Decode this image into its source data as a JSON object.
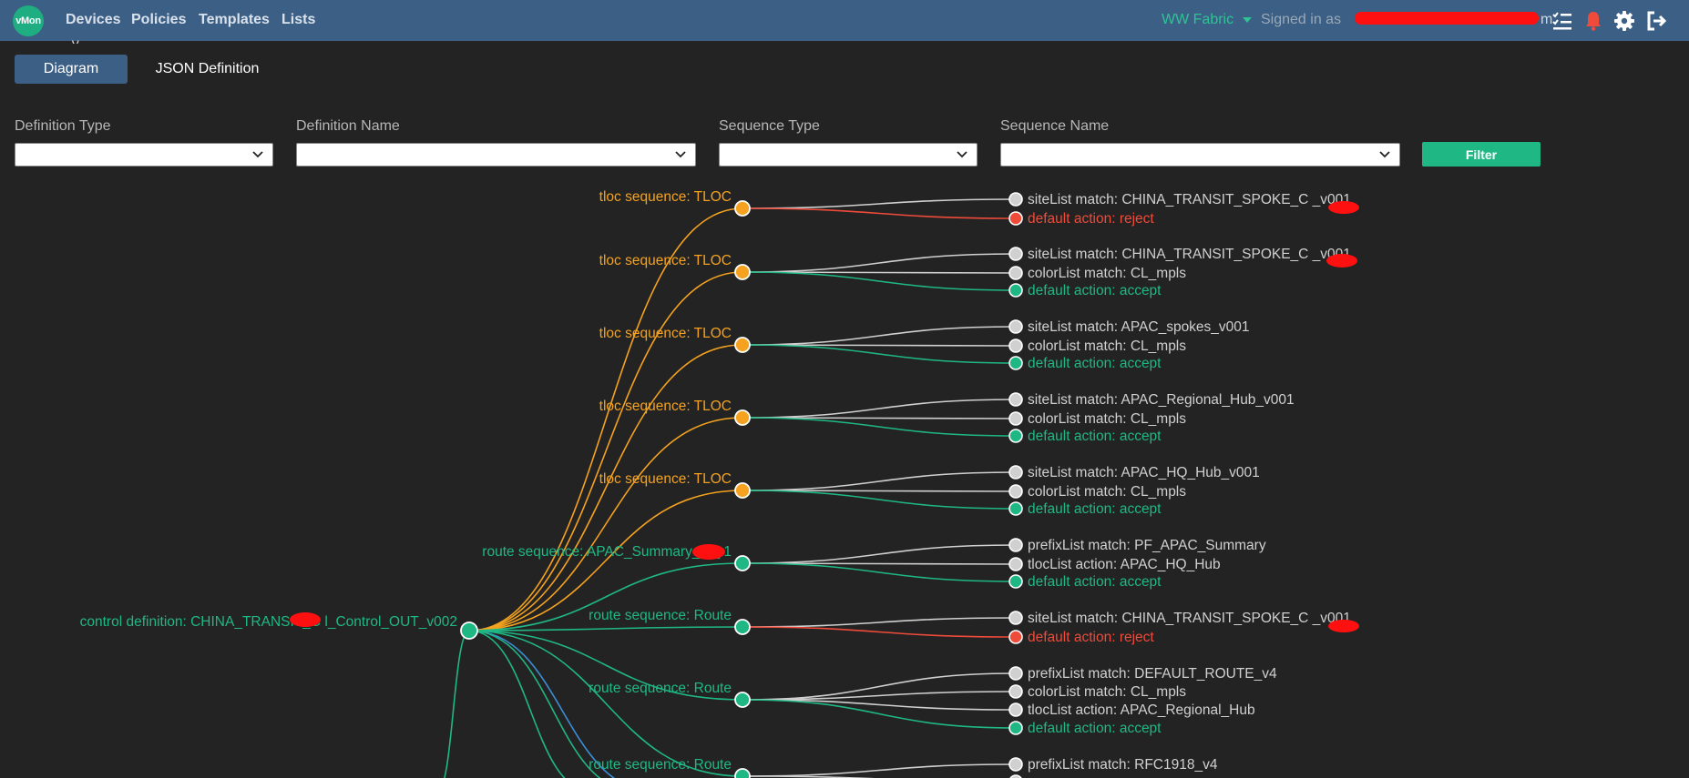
{
  "app": {
    "logo_text": "vMon"
  },
  "nav": {
    "links": [
      "Devices",
      "Policies",
      "Templates",
      "Lists"
    ],
    "fabric": "WW Fabric",
    "signed_in_label": "Signed in as",
    "user_visible_suffix": "m"
  },
  "page": {
    "title_fragment": "_  _ y_"
  },
  "tabs": [
    "Diagram",
    "JSON Definition"
  ],
  "filters": {
    "definition_type": {
      "label": "Definition Type",
      "value": ""
    },
    "definition_name": {
      "label": "Definition Name",
      "value": ""
    },
    "sequence_type": {
      "label": "Sequence Type",
      "value": ""
    },
    "sequence_name": {
      "label": "Sequence Name",
      "value": ""
    },
    "button": "Filter"
  },
  "colors": {
    "tloc": "#f4a21f",
    "route": "#1fb885",
    "match": "#d0d0d0",
    "reject": "#ee4b3a",
    "accept": "#1fb885",
    "link_blue": "#3b8fd6"
  },
  "tree": {
    "root": "control definition: CHINA_TRANSIT_C   l_Control_OUT_v002",
    "sequences": [
      {
        "label": "tloc sequence: TLOC",
        "kind": "tloc",
        "children": [
          {
            "label": "siteList match: CHINA_TRANSIT_SPOKE_C      _v001",
            "kind": "match"
          },
          {
            "label": "default action: reject",
            "kind": "reject"
          }
        ]
      },
      {
        "label": "tloc sequence: TLOC",
        "kind": "tloc",
        "children": [
          {
            "label": "siteList match: CHINA_TRANSIT_SPOKE_C      _v001",
            "kind": "match"
          },
          {
            "label": "colorList match: CL_mpls",
            "kind": "match"
          },
          {
            "label": "default action: accept",
            "kind": "accept"
          }
        ]
      },
      {
        "label": "tloc sequence: TLOC",
        "kind": "tloc",
        "children": [
          {
            "label": "siteList match: APAC_spokes_v001",
            "kind": "match"
          },
          {
            "label": "colorList match: CL_mpls",
            "kind": "match"
          },
          {
            "label": "default action: accept",
            "kind": "accept"
          }
        ]
      },
      {
        "label": "tloc sequence: TLOC",
        "kind": "tloc",
        "children": [
          {
            "label": "siteList match: APAC_Regional_Hub_v001",
            "kind": "match"
          },
          {
            "label": "colorList match: CL_mpls",
            "kind": "match"
          },
          {
            "label": "default action: accept",
            "kind": "accept"
          }
        ]
      },
      {
        "label": "tloc sequence: TLOC",
        "kind": "tloc",
        "children": [
          {
            "label": "siteList match: APAC_HQ_Hub_v001",
            "kind": "match"
          },
          {
            "label": "colorList match: CL_mpls",
            "kind": "match"
          },
          {
            "label": "default action: accept",
            "kind": "accept"
          }
        ]
      },
      {
        "label": "route sequence: APAC_Summary_to_     1",
        "kind": "route",
        "children": [
          {
            "label": "prefixList match: PF_APAC_Summary",
            "kind": "match"
          },
          {
            "label": "tlocList action: APAC_HQ_Hub",
            "kind": "match"
          },
          {
            "label": "default action: accept",
            "kind": "accept"
          }
        ]
      },
      {
        "label": "route sequence: Route",
        "kind": "route",
        "children": [
          {
            "label": "siteList match: CHINA_TRANSIT_SPOKE_C      _v001",
            "kind": "match"
          },
          {
            "label": "default action: reject",
            "kind": "reject"
          }
        ]
      },
      {
        "label": "route sequence: Route",
        "kind": "route",
        "children": [
          {
            "label": "prefixList match: DEFAULT_ROUTE_v4",
            "kind": "match"
          },
          {
            "label": "colorList match: CL_mpls",
            "kind": "match"
          },
          {
            "label": "tlocList action: APAC_Regional_Hub",
            "kind": "match"
          },
          {
            "label": "default action: accept",
            "kind": "accept"
          }
        ]
      },
      {
        "label": "route sequence: Route",
        "kind": "route",
        "children": [
          {
            "label": "prefixList match: RFC1918_v4",
            "kind": "match"
          },
          {
            "label": "",
            "kind": "match"
          }
        ]
      }
    ]
  }
}
